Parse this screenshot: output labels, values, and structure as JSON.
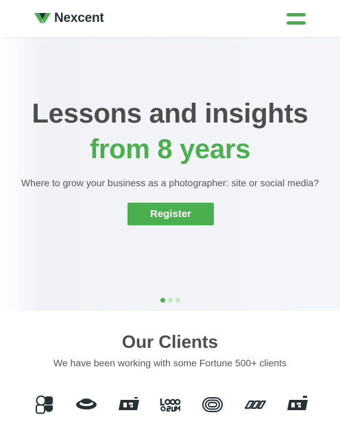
{
  "header": {
    "brand_name": "Nexcent",
    "logo_icon": "nexcent-logo-icon",
    "menu_icon": "hamburger-menu-icon",
    "accent_color": "#4caf4f"
  },
  "hero": {
    "title_line_1": "Lessons and insights",
    "title_line_2": "from 8 years",
    "subtitle": "Where to grow your business as a photographer: site or social media?",
    "register_label": "Register",
    "carousel": {
      "slide_count": 3,
      "active_index": 0
    }
  },
  "clients": {
    "title": "Our Clients",
    "subtitle": "We have been working with some Fortune 500+ clients",
    "logos": [
      "client-logo-1-icon",
      "client-logo-2-icon",
      "client-logo-3-icon",
      "client-logo-4-icon",
      "client-logo-5-icon",
      "client-logo-6-icon",
      "client-logo-7-icon"
    ]
  },
  "colors": {
    "primary": "#4caf4f",
    "text_dark": "#4d4d4d",
    "text_grey": "#555555",
    "hero_bg": "#f5f6fa"
  }
}
